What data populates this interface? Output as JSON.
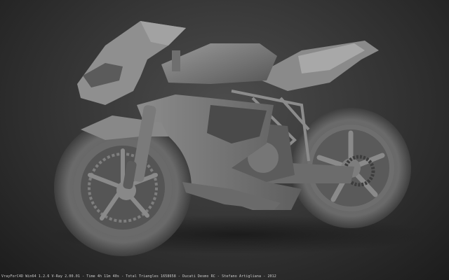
{
  "render": {
    "subject": "Ducati Desmosedici motorcycle clay render",
    "background_color": "#2f2f2f",
    "model_color": "#7a7a7a",
    "info_line": "VrayForC4D Win64 1.2.6 V-Ray 2.00.01 - Time 4h 11m 40s - Total Triangles 1658658 - Ducati Desmo RC - Stefano Artigliana - 2012"
  }
}
